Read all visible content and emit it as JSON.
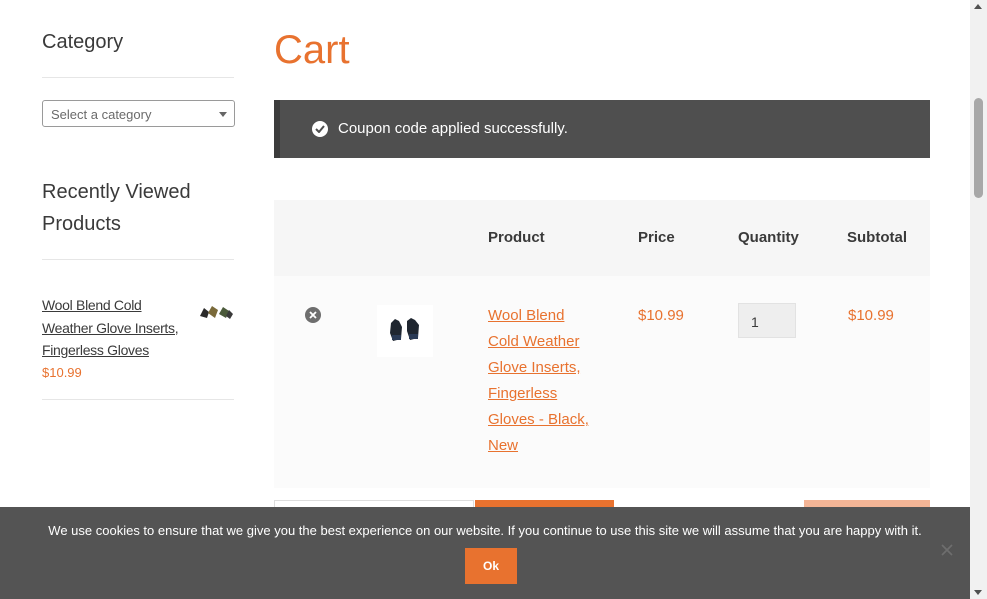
{
  "sidebar": {
    "category_title": "Category",
    "category_select_placeholder": "Select a category",
    "recently_viewed_title": "Recently Viewed Products",
    "recently_viewed_items": [
      {
        "name": "Wool Blend Cold Weather Glove Inserts, Fingerless Gloves",
        "price": "$10.99"
      }
    ]
  },
  "main": {
    "page_title": "Cart",
    "notice": {
      "message": "Coupon code applied successfully.",
      "icon": "check-circle-icon"
    },
    "cart_table": {
      "headers": {
        "product": "Product",
        "price": "Price",
        "quantity": "Quantity",
        "subtotal": "Subtotal"
      },
      "rows": [
        {
          "product_name": "Wool Blend Cold Weather Glove Inserts, Fingerless Gloves - Black, New",
          "price": "$10.99",
          "quantity": "1",
          "subtotal": "$10.99"
        }
      ]
    }
  },
  "cookie_bar": {
    "message": "We use cookies to ensure that we give you the best experience on our website. If you continue to use this site we will assume that you are happy with it.",
    "ok_label": "Ok"
  },
  "colors": {
    "accent": "#e8722f",
    "notice_bg": "#4f4f4f",
    "cookie_bg": "#545454"
  }
}
